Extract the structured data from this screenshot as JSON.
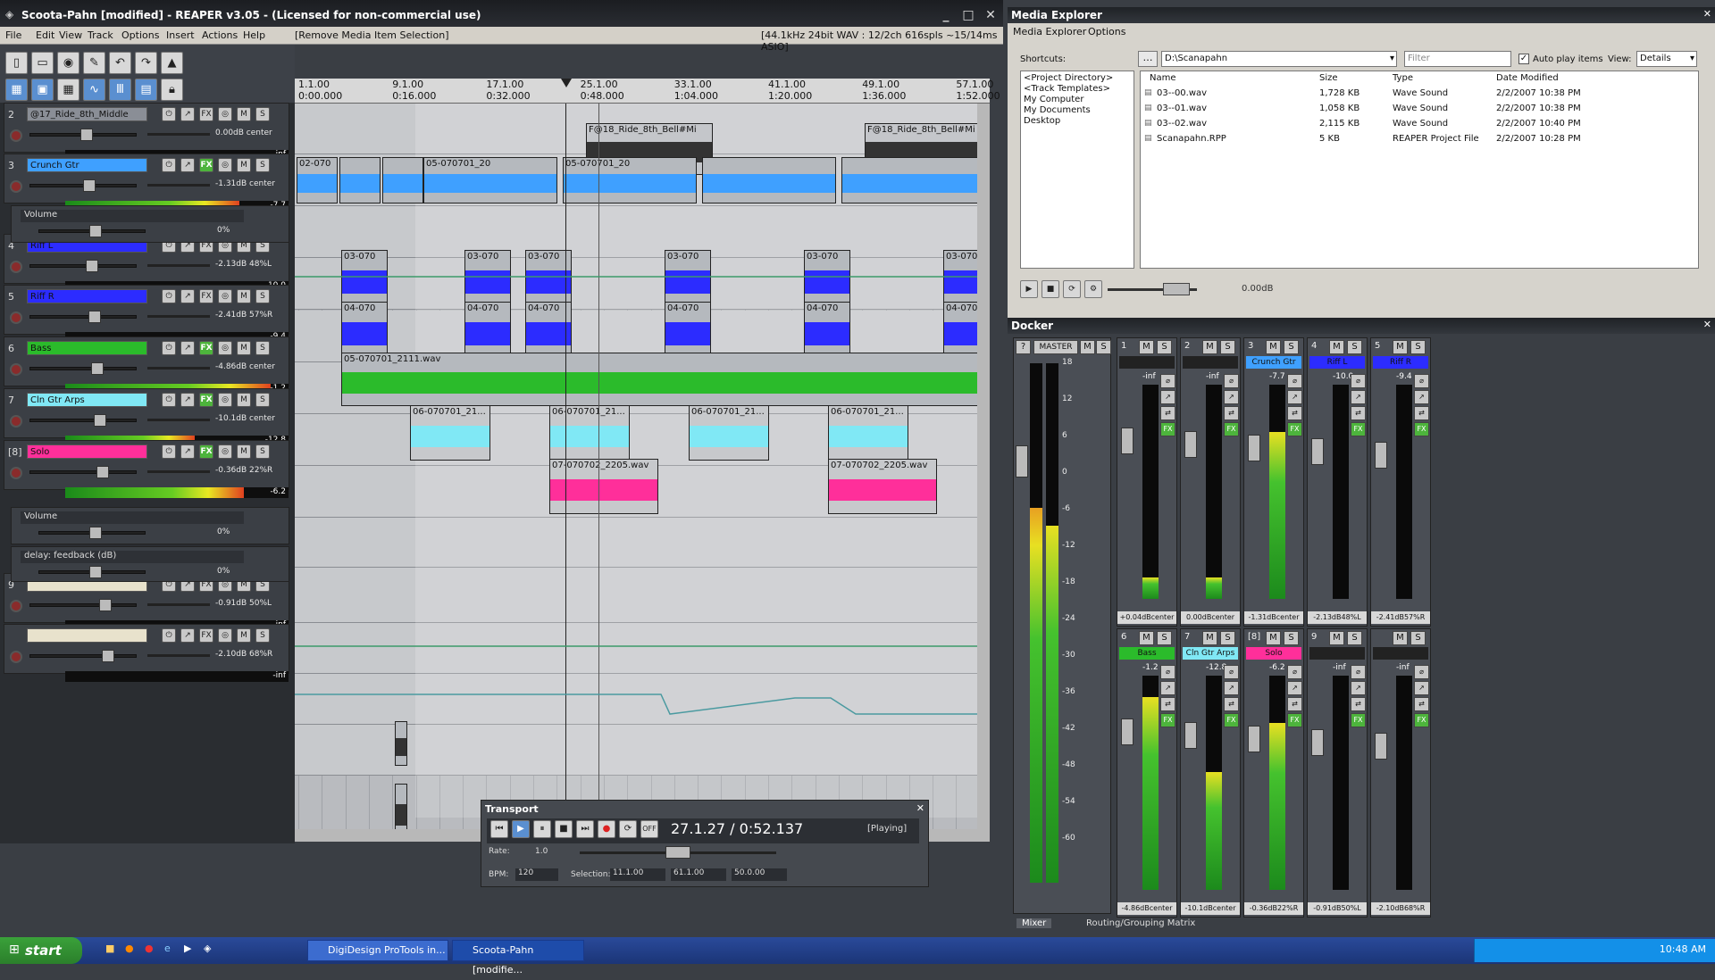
{
  "title": "Scoota-Pahn [modified] - REAPER v3.05 - (Licensed for non-commercial use)",
  "menu": [
    "File",
    "Edit",
    "View",
    "Track",
    "Options",
    "Insert",
    "Actions",
    "Help"
  ],
  "menu_status": "[Remove Media Item Selection]",
  "audio_status": "[44.1kHz 24bit WAV : 12/2ch 616spls ~15/14ms ASIO]",
  "ruler": [
    {
      "bar": "1.1.00",
      "time": "0:00.000"
    },
    {
      "bar": "9.1.00",
      "time": "0:16.000"
    },
    {
      "bar": "17.1.00",
      "time": "0:32.000"
    },
    {
      "bar": "25.1.00",
      "time": "0:48.000"
    },
    {
      "bar": "33.1.00",
      "time": "1:04.000"
    },
    {
      "bar": "41.1.00",
      "time": "1:20.000"
    },
    {
      "bar": "49.1.00",
      "time": "1:36.000"
    },
    {
      "bar": "57.1.00",
      "time": "1:52.000"
    }
  ],
  "tracks": [
    {
      "num": "2",
      "name": "@17_Ride_8th_Middle",
      "db": "0.00dB center",
      "meter": "-inf",
      "level": 0.0
    },
    {
      "num": "3",
      "name": "Crunch Gtr",
      "db": "-1.31dB center",
      "meter": "-7.7",
      "level": 0.78
    },
    {
      "num": "4",
      "name": "Riff L",
      "db": "-2.13dB 48%L",
      "meter": "-10.0",
      "level": 0.0
    },
    {
      "num": "5",
      "name": "Riff R",
      "db": "-2.41dB 57%R",
      "meter": "-9.4",
      "level": 0.0
    },
    {
      "num": "6",
      "name": "Bass",
      "db": "-4.86dB center",
      "meter": "-1.2",
      "level": 0.92
    },
    {
      "num": "7",
      "name": "Cln Gtr Arps",
      "db": "-10.1dB center",
      "meter": "-12.8",
      "level": 0.58
    },
    {
      "num": "[8]",
      "name": "Solo",
      "db": "-0.36dB 22%R",
      "meter": "-6.2",
      "level": 0.8
    },
    {
      "num": "9",
      "name": "",
      "db": "-0.91dB 50%L",
      "meter": "-inf",
      "level": 0.0
    },
    {
      "num": "",
      "name": "",
      "db": "-2.10dB 68%R",
      "meter": "-inf",
      "level": 0.0
    }
  ],
  "envelopes": [
    {
      "name": "Volume",
      "val": "0%"
    },
    {
      "name": "Volume",
      "val": "0%"
    },
    {
      "name": "delay: feedback (dB)",
      "val": "0%"
    }
  ],
  "items": {
    "ride": "F@18_Ride_8th_Bell#Mi",
    "crunch1": "02-070",
    "crunch2": "05-070701_20",
    "crunch3": "05-070701_20",
    "riff": "03-070",
    "riffr": "04-070",
    "bass": "05-070701_2111.wav",
    "cln": "06-070701_21...",
    "solo": "07-070702_2205.wav"
  },
  "transport": {
    "title": "Transport",
    "position": "27.1.27 / 0:52.137",
    "status": "[Playing]",
    "rate_label": "Rate:",
    "rate": "1.0",
    "bpm_label": "BPM:",
    "bpm": "120",
    "sel_label": "Selection:",
    "sel_start": "11.1.00",
    "sel_end": "61.1.00",
    "sel_len": "50.0.00"
  },
  "media_explorer": {
    "title": "Media Explorer",
    "menu": [
      "Media Explorer",
      "Options"
    ],
    "shortcuts_label": "Shortcuts:",
    "path": "D:\\Scanapahn",
    "filter": "Filter",
    "autoplay": "Auto play items",
    "view_label": "View:",
    "view": "Details",
    "shortcuts": [
      "<Project Directory>",
      "<Track Templates>",
      "My Computer",
      "My Documents",
      "Desktop"
    ],
    "columns": [
      "Name",
      "Size",
      "Type",
      "Date Modified"
    ],
    "files": [
      [
        "03--00.wav",
        "1,728 KB",
        "Wave Sound",
        "2/2/2007 10:38 PM"
      ],
      [
        "03--01.wav",
        "1,058 KB",
        "Wave Sound",
        "2/2/2007 10:38 PM"
      ],
      [
        "03--02.wav",
        "2,115 KB",
        "Wave Sound",
        "2/2/2007 10:40 PM"
      ],
      [
        "Scanapahn.RPP",
        "5 KB",
        "REAPER Project File",
        "2/2/2007 10:28 PM"
      ]
    ],
    "volume": "0.00dB"
  },
  "docker": {
    "title": "Docker",
    "master": "MASTER",
    "master_scale": [
      "18",
      "12",
      "6",
      "0",
      "-6",
      "-12",
      "-18",
      "-24",
      "-30",
      "-36",
      "-42",
      "-48",
      "-54",
      "-60"
    ],
    "strips_top": [
      {
        "num": "1",
        "name": "",
        "peak": "-inf",
        "db": "+0.04dBcenter",
        "level": 0.1
      },
      {
        "num": "2",
        "name": "",
        "peak": "-inf",
        "db": "0.00dBcenter",
        "level": 0.1
      },
      {
        "num": "3",
        "name": "Crunch Gtr",
        "peak": "-7.7",
        "db": "-1.31dBcenter",
        "level": 0.78
      },
      {
        "num": "4",
        "name": "Riff L",
        "peak": "-10.0",
        "db": "-2.13dB48%L",
        "level": 0.0
      },
      {
        "num": "5",
        "name": "Riff R",
        "peak": "-9.4",
        "db": "-2.41dB57%R",
        "level": 0.0
      }
    ],
    "strips_bot": [
      {
        "num": "6",
        "name": "Bass",
        "peak": "-1.2",
        "db": "-4.86dBcenter",
        "level": 0.9
      },
      {
        "num": "7",
        "name": "Cln Gtr Arps",
        "peak": "-12.8",
        "db": "-10.1dBcenter",
        "level": 0.55
      },
      {
        "num": "[8]",
        "name": "Solo",
        "peak": "-6.2",
        "db": "-0.36dB22%R",
        "level": 0.78
      },
      {
        "num": "9",
        "name": "",
        "peak": "-inf",
        "db": "-0.91dB50%L",
        "level": 0.0
      },
      {
        "num": "",
        "name": "",
        "peak": "-inf",
        "db": "-2.10dB68%R",
        "level": 0.0
      }
    ],
    "tabs": [
      "Mixer",
      "Routing/Grouping Matrix"
    ]
  },
  "taskbar": {
    "start": "start",
    "tasks": [
      "DigiDesign ProTools in...",
      "Scoota-Pahn [modifie..."
    ],
    "clock": "10:48 AM"
  },
  "colors": {
    "crunch": "#3fa0ff",
    "riff": "#2c2cff",
    "bass": "#2bbb2b",
    "cln": "#80e8f5",
    "solo": "#ff2f9a",
    "accent": "#5a8fd0"
  }
}
